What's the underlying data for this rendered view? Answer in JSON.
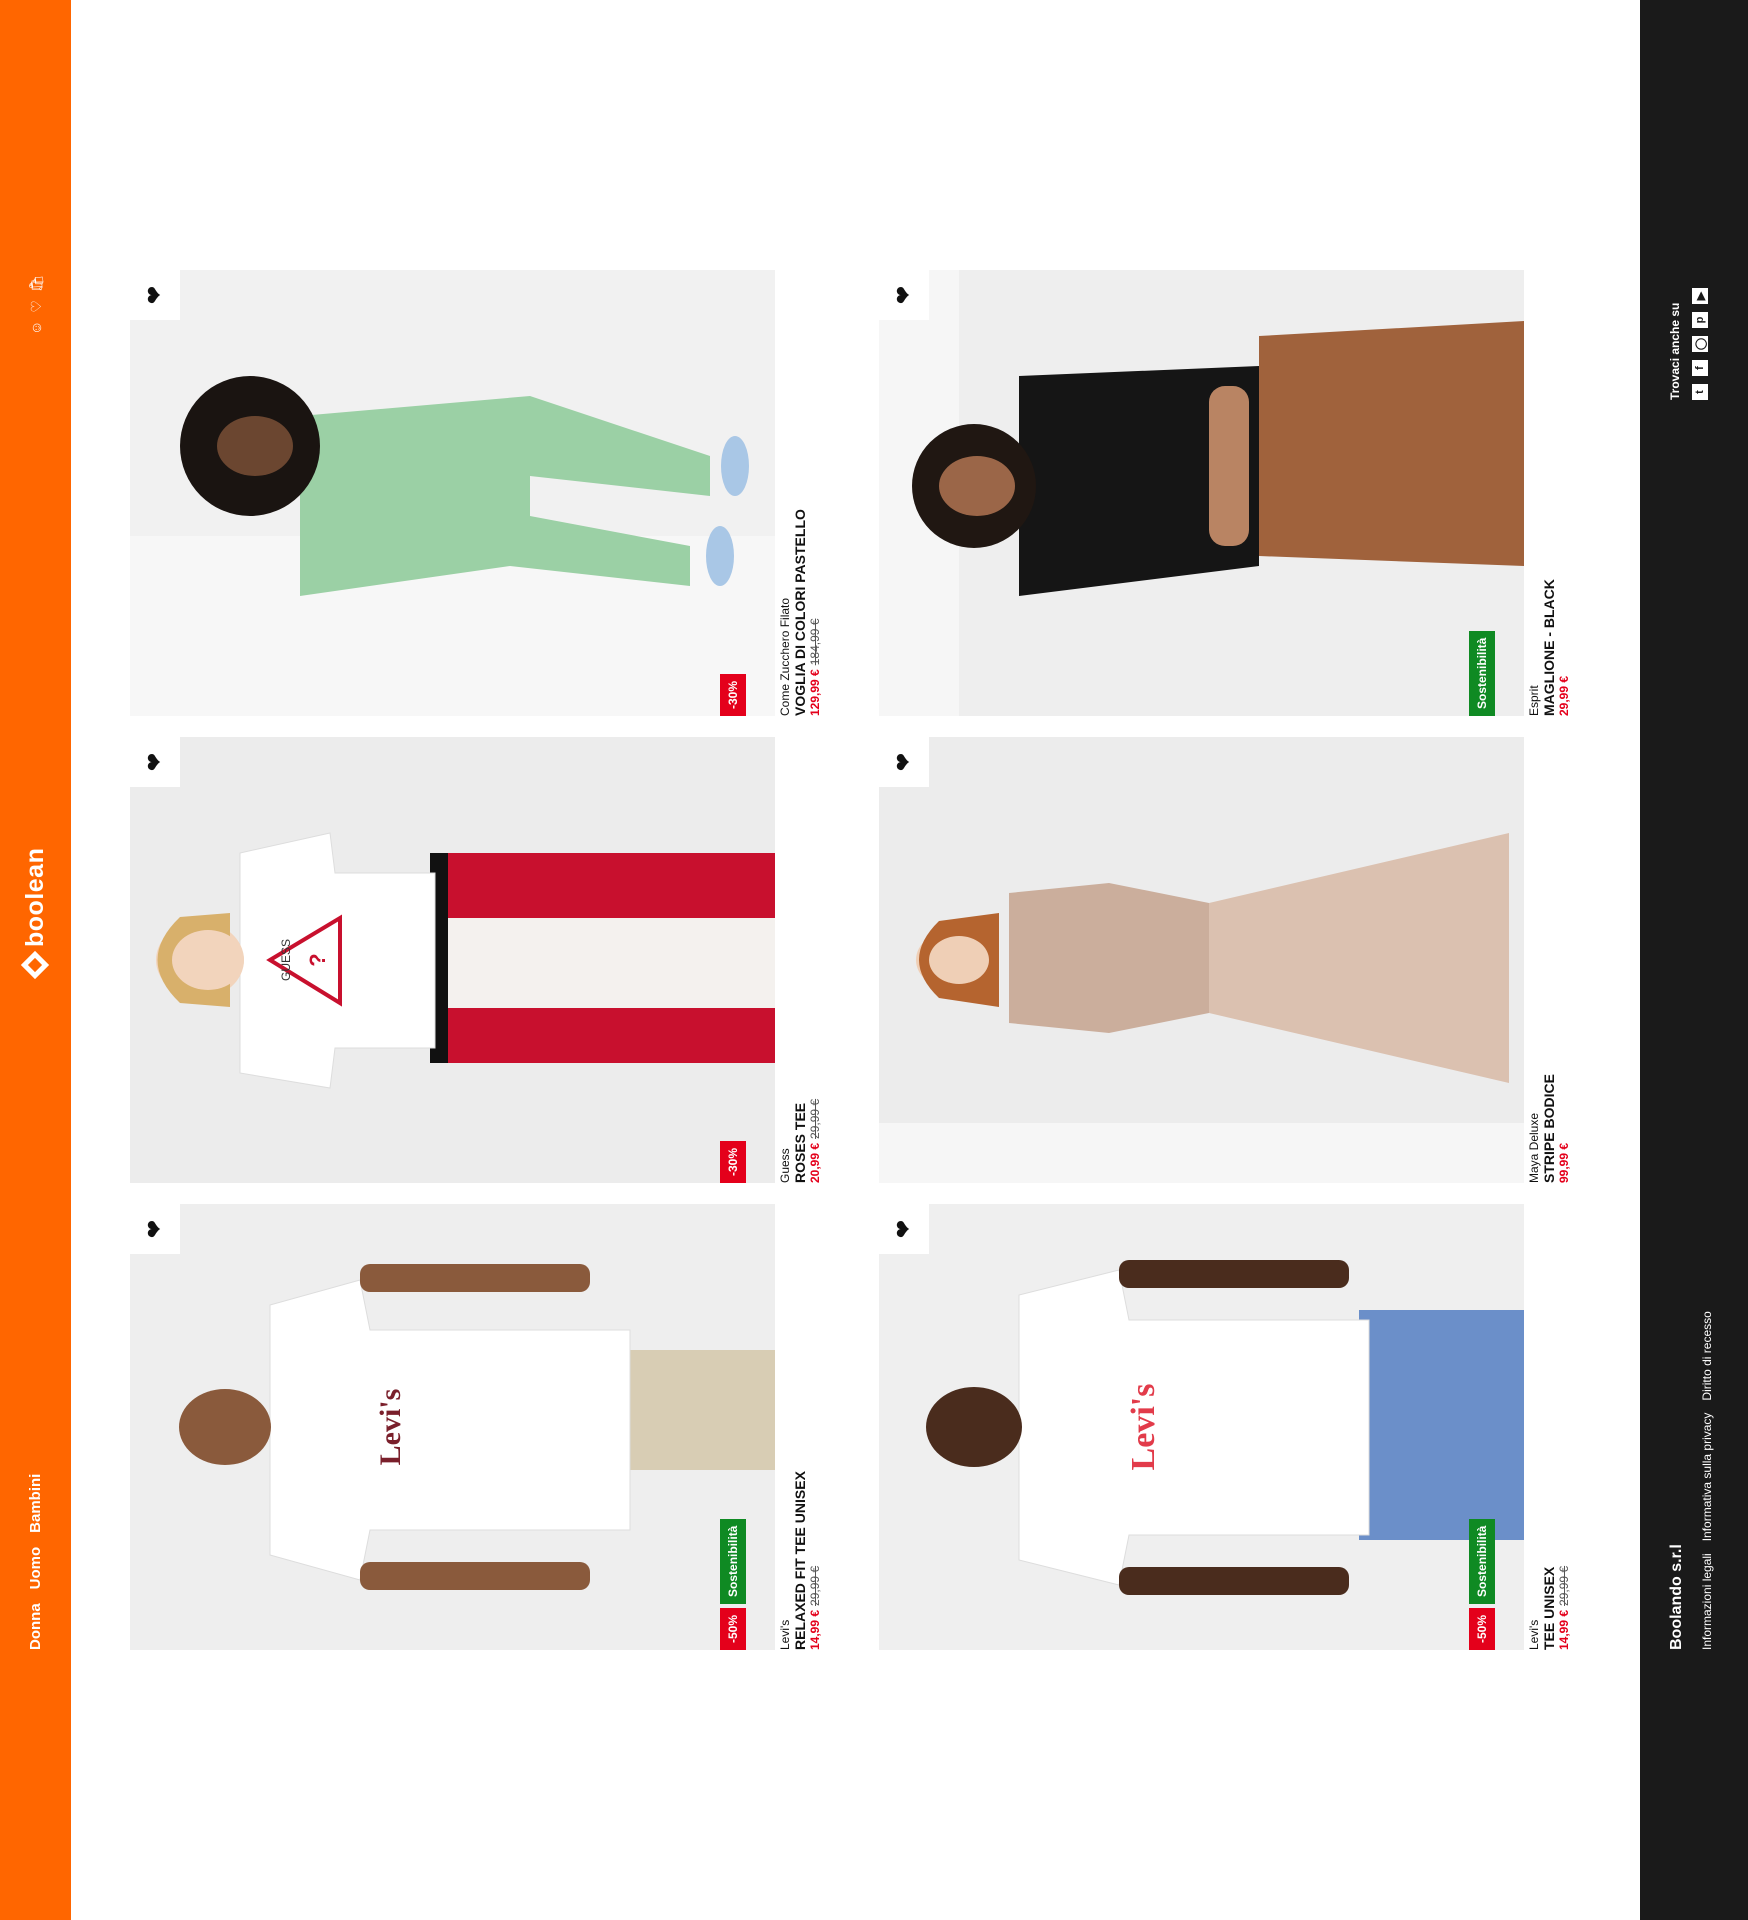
{
  "header": {
    "nav": [
      "Donna",
      "Uomo",
      "Bambini"
    ],
    "logo": "boolean",
    "icons": [
      "user-icon",
      "heart-icon",
      "bag-icon"
    ],
    "color": "#ff6600"
  },
  "products": [
    {
      "brand": "Levi's",
      "name": "RELAXED FIT TEE UNISEX",
      "price": "14,99 €",
      "old_price": "29,99 €",
      "badges": [
        "-50%",
        "Sostenibilità"
      ]
    },
    {
      "brand": "Guess",
      "name": "ROSES TEE",
      "price": "20,99 €",
      "old_price": "29,99 €",
      "badges": [
        "-30%"
      ]
    },
    {
      "brand": "Come Zucchero Filato",
      "name": "VOGLIA DI COLORI PASTELLO",
      "price": "129,99 €",
      "old_price": "184,99 €",
      "badges": [
        "-30%"
      ]
    },
    {
      "brand": "Levi's",
      "name": "TEE UNISEX",
      "price": "14,99 €",
      "old_price": "29,99 €",
      "badges": [
        "-50%",
        "Sostenibilità"
      ]
    },
    {
      "brand": "Maya Deluxe",
      "name": "STRIPE BODICE",
      "price": "99,99 €",
      "old_price": "",
      "badges": []
    },
    {
      "brand": "Esprit",
      "name": "MAGLIONE - BLACK",
      "price": "29,99 €",
      "old_price": "",
      "badges": [
        "Sostenibilità"
      ]
    }
  ],
  "footer": {
    "company": "Boolando s.r.l",
    "links": [
      "Informazioni legali",
      "Informativa sulla privacy",
      "Diritto di recesso"
    ],
    "follow_title": "Trovaci anche su",
    "social": [
      "twitter-icon",
      "facebook-icon",
      "instagram-icon",
      "pinterest-icon",
      "youtube-icon"
    ]
  }
}
